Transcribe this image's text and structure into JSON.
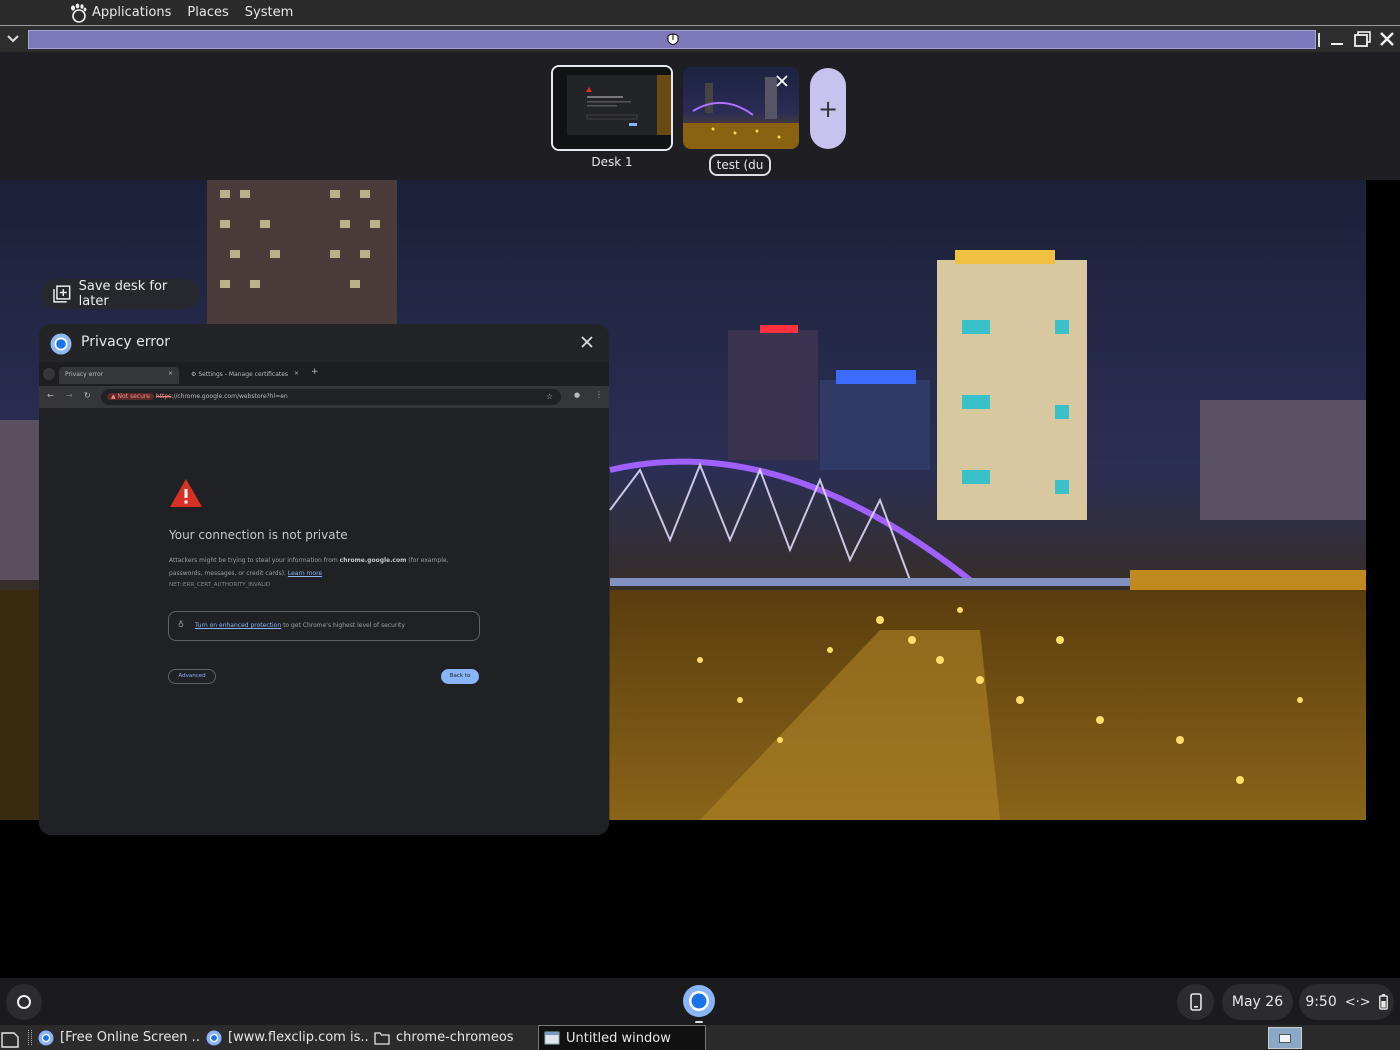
{
  "top_panel": {
    "menus": [
      "Applications",
      "Places",
      "System"
    ]
  },
  "desks": {
    "desk1_label": "Desk 1",
    "desk2_name": "test (du",
    "new_desk_symbol": "+"
  },
  "overview": {
    "save_desk_label": "Save desk for later",
    "window_title": "Privacy error"
  },
  "browser": {
    "tabs": [
      "Privacy error",
      "Settings - Manage certificates"
    ],
    "security_chip": "Not secure",
    "url_scheme": "https",
    "url_rest": "://chrome.google.com/webstore?hl=en"
  },
  "page": {
    "heading": "Your connection is not private",
    "body_before": "Attackers might be trying to steal your information from ",
    "body_domain": "chrome.google.com",
    "body_after": " (for example, passwords, messages, or credit cards). ",
    "learn_more": "Learn more",
    "error_code": "NET::ERR_CERT_AUTHORITY_INVALID",
    "enhanced_link": "Turn on enhanced protection",
    "enhanced_rest": " to get Chrome's highest level of security",
    "advanced_label": "Advanced",
    "back_label": "Back to safety"
  },
  "shelf": {
    "date": "May 26",
    "time": "9:50"
  },
  "taskbar": {
    "items": [
      "[Free Online Screen ...",
      "[www.flexclip.com is...",
      "chrome-chromeos",
      "Untitled window"
    ]
  },
  "colors": {
    "accent_bar": "#7d78b8",
    "new_desk": "#c8c3ee",
    "link": "#8ab4f8",
    "warning": "#d93025"
  }
}
